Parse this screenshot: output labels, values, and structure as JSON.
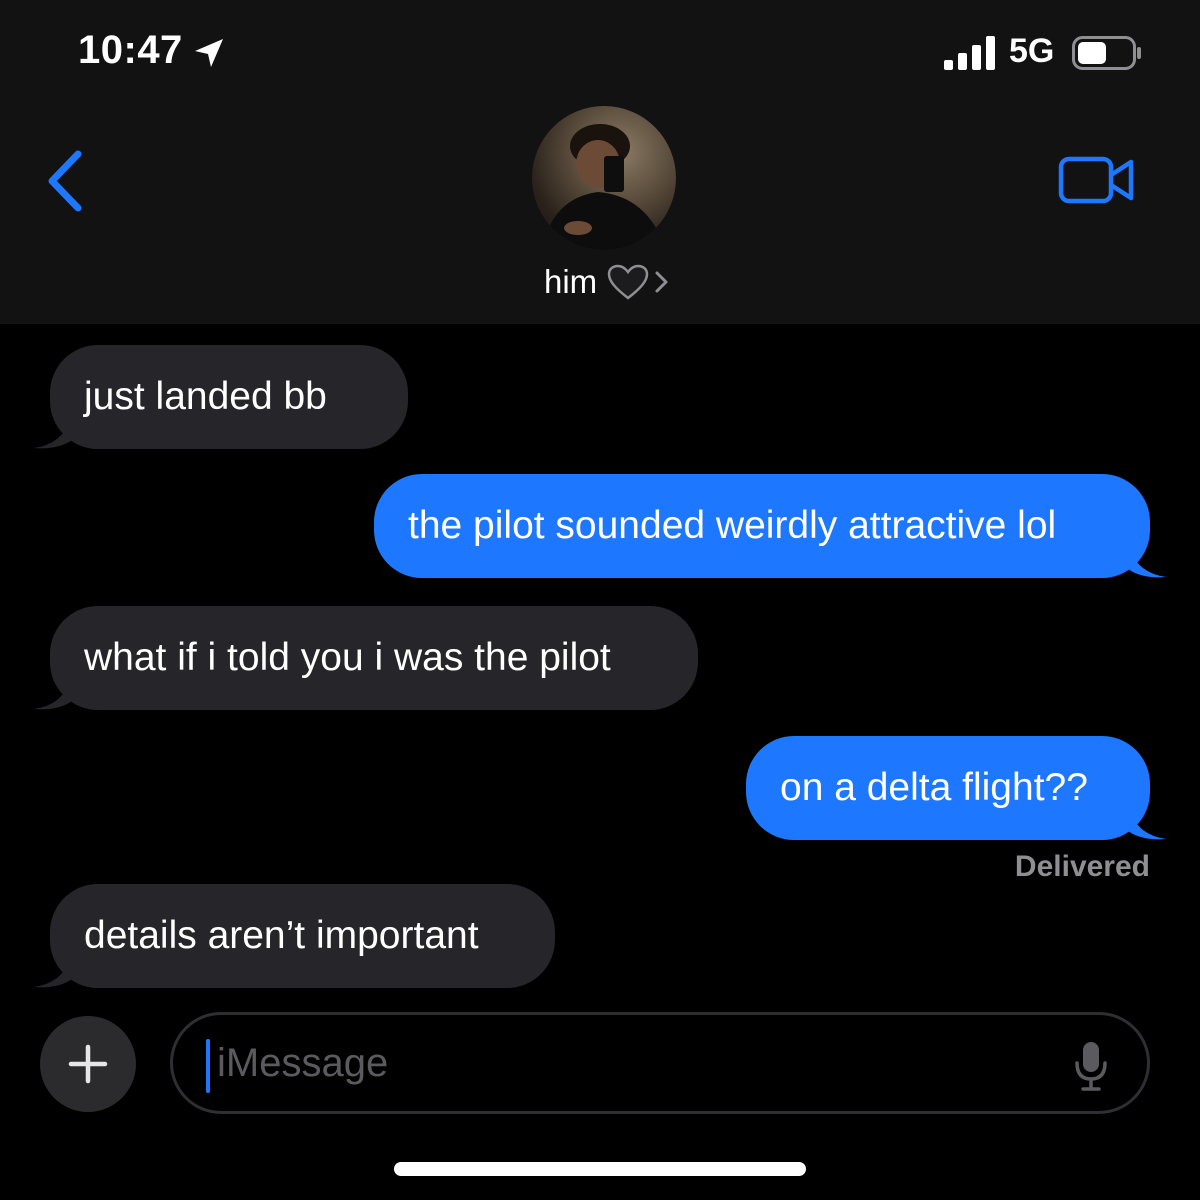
{
  "status_bar": {
    "time": "10:47",
    "location_icon": "location-arrow-icon",
    "signal_icon": "cellular-signal-icon",
    "network": "5G",
    "battery_icon": "battery-icon"
  },
  "header": {
    "back_icon": "chevron-left-icon",
    "avatar": "contact-avatar-photo",
    "contact_name": "him",
    "heart_icon": "black-heart-icon",
    "details_chevron_icon": "chevron-right-icon",
    "video_icon": "video-camera-icon"
  },
  "messages": [
    {
      "direction": "incoming",
      "text": "just landed bb"
    },
    {
      "direction": "outgoing",
      "text": "the pilot sounded weirdly attractive lol"
    },
    {
      "direction": "incoming",
      "text": "what if i told you i was the pilot"
    },
    {
      "direction": "outgoing",
      "text": "on a delta flight??"
    },
    {
      "direction": "incoming",
      "text": "details aren’t important"
    }
  ],
  "delivery_status": "Delivered",
  "composer": {
    "plus_icon": "plus-icon",
    "placeholder": "iMessage",
    "mic_icon": "microphone-icon"
  },
  "colors": {
    "accent": "#1e78ff",
    "incoming_bubble": "#26252a",
    "header_bg": "#121212",
    "background": "#000000"
  }
}
